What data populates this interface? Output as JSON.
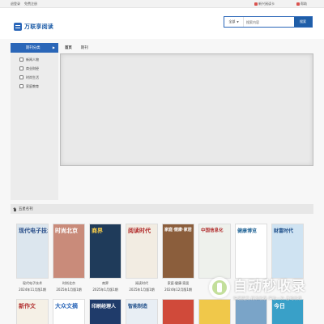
{
  "topbar": {
    "left_links": [
      "退登录",
      "免费注册"
    ],
    "right_links": [
      "新兴阅读卡",
      "帮助"
    ],
    "accent": "#d9534f"
  },
  "header": {
    "logo_text": "万联享阅读",
    "brand_color": "#1f5ea8"
  },
  "search": {
    "scope": "全部",
    "placeholder": "搜索内容",
    "button": "搜索"
  },
  "sidebar": {
    "heading": "期刊分类",
    "items": [
      "新闻人物",
      "商业财经",
      "时尚生活",
      "家庭教育"
    ]
  },
  "tabs": [
    "首页",
    "期刊"
  ],
  "section": {
    "title": "五星名刊"
  },
  "magazines": [
    {
      "title": "现代电子技术",
      "date": "2024年11月版1期",
      "bg": "#dce6ee",
      "fg": "#2a4f8a"
    },
    {
      "title": "时尚北京",
      "date": "2025年1月版1期",
      "bg": "#c98b7a",
      "fg": "#ffffff"
    },
    {
      "title": "商界",
      "date": "2025年1月版1期",
      "bg": "#1f3b5a",
      "fg": "#ffd24a"
    },
    {
      "title": "阅读时代",
      "date": "2025年1月版1期",
      "bg": "#f2ece2",
      "fg": "#b12a2a"
    },
    {
      "title": "家庭·健康·家居",
      "date": "2024年12月版1期",
      "bg": "#8b5e3c",
      "fg": "#ffffff"
    },
    {
      "title": "中国信息化",
      "date": "",
      "bg": "#eef1ec",
      "fg": "#b23030"
    },
    {
      "title": "健康博览",
      "date": "",
      "bg": "#ffffff",
      "fg": "#2a6a9a"
    },
    {
      "title": "财富时代",
      "date": "",
      "bg": "#cfe3f2",
      "fg": "#1f4f8a"
    }
  ],
  "magazines_row2": [
    {
      "title": "新作文",
      "bg": "#f5f0e6",
      "fg": "#b23030"
    },
    {
      "title": "大众文摘",
      "bg": "#ffffff",
      "fg": "#2a66b8"
    },
    {
      "title": "印刷经理人",
      "bg": "#1f3b6a",
      "fg": "#ffffff"
    },
    {
      "title": "智能制造",
      "bg": "#e8eef4",
      "fg": "#1f4f8a"
    },
    {
      "title": "",
      "bg": "#d04a3a",
      "fg": "#ffffff"
    },
    {
      "title": "",
      "bg": "#f0c84a",
      "fg": "#333333"
    },
    {
      "title": "",
      "bg": "#7aa4c8",
      "fg": "#ffffff"
    },
    {
      "title": "今日",
      "bg": "#39a0c8",
      "fg": "#ffffff"
    }
  ],
  "watermark": {
    "main": "自动秒收录",
    "sub": "快速提交·精准收录·来访一次·自动收录"
  }
}
